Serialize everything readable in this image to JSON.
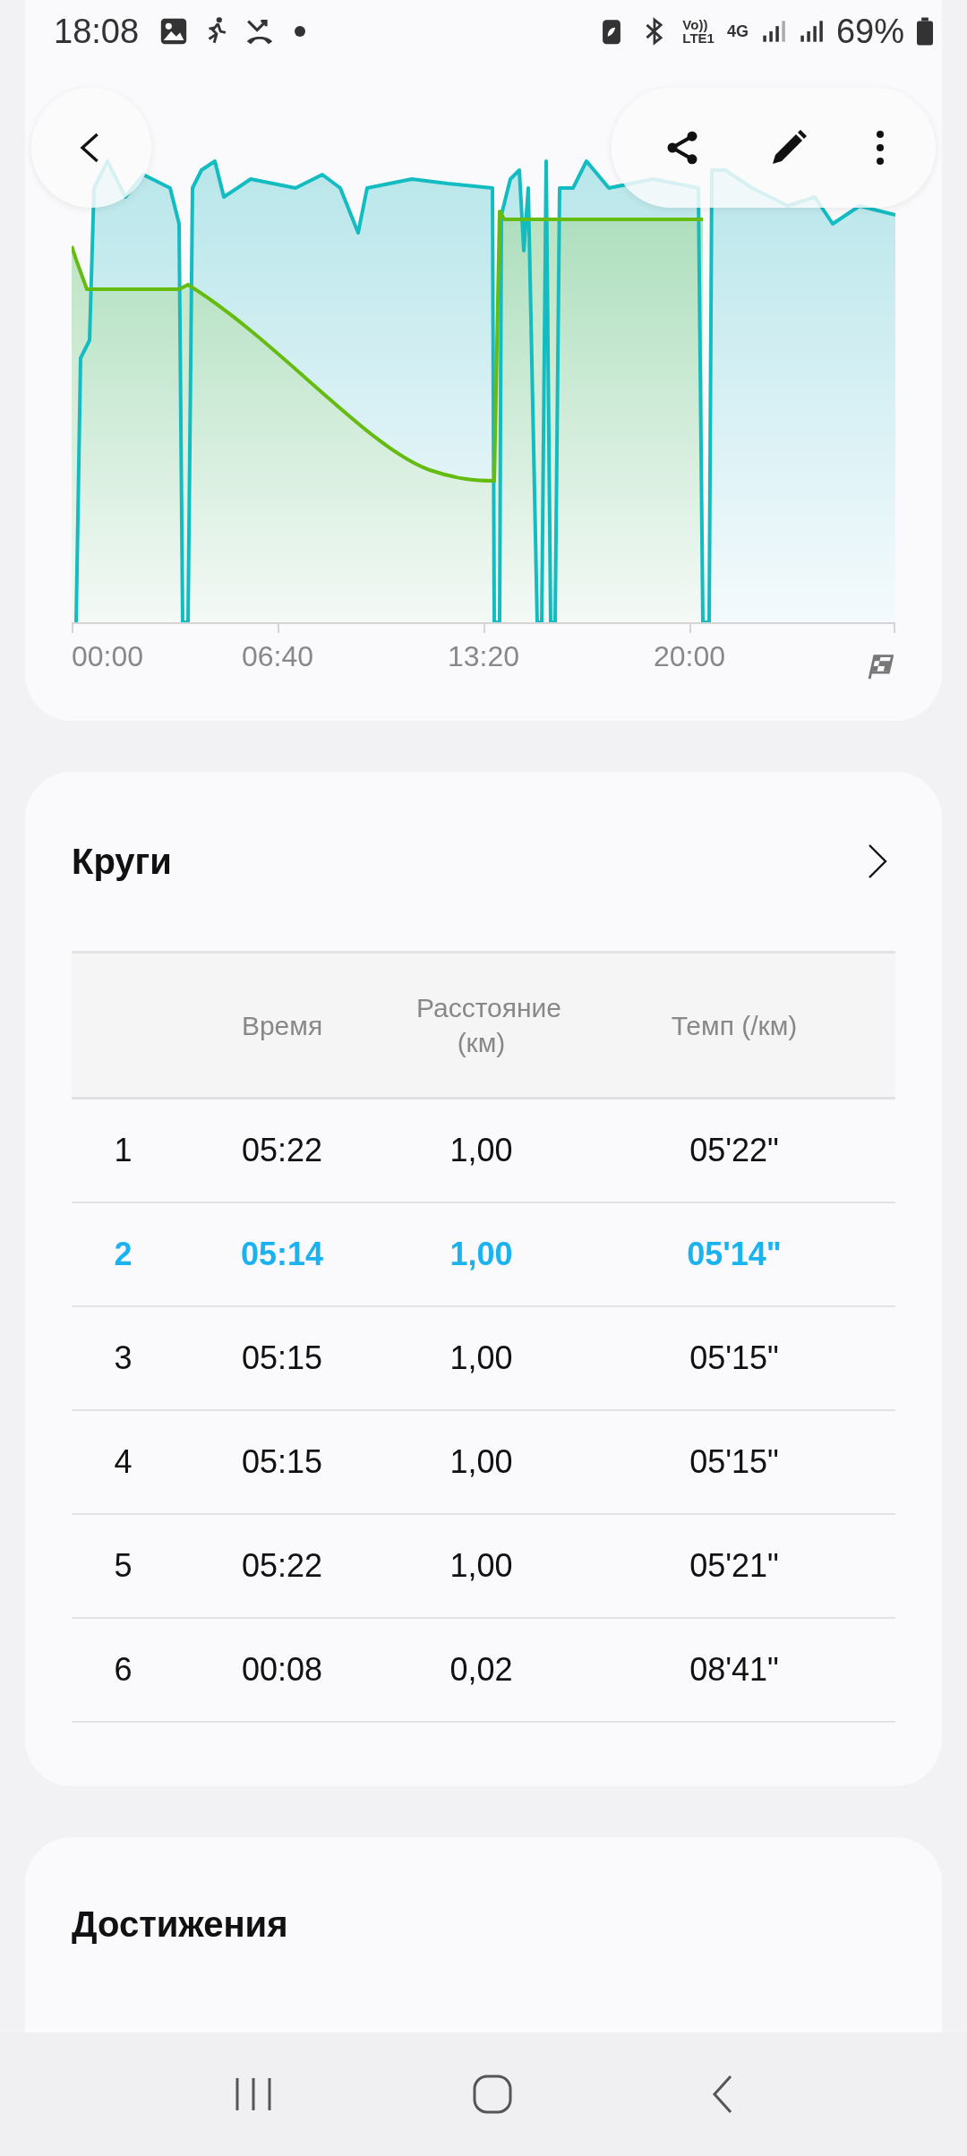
{
  "status_bar": {
    "time": "18:08",
    "volte": "Vo))",
    "lte": "LTE1",
    "network": "4G",
    "battery": "69%"
  },
  "chart": {
    "x_labels": [
      "00:00",
      "06:40",
      "13:20",
      "20:00"
    ]
  },
  "laps": {
    "title": "Круги",
    "columns": [
      "Время",
      "Расстояние (км)",
      "Темп (/км)"
    ],
    "rows": [
      {
        "lap": "1",
        "time": "05:22",
        "distance": "1,00",
        "pace": "05'22\"",
        "selected": false
      },
      {
        "lap": "2",
        "time": "05:14",
        "distance": "1,00",
        "pace": "05'14\"",
        "selected": true
      },
      {
        "lap": "3",
        "time": "05:15",
        "distance": "1,00",
        "pace": "05'15\"",
        "selected": false
      },
      {
        "lap": "4",
        "time": "05:15",
        "distance": "1,00",
        "pace": "05'15\"",
        "selected": false
      },
      {
        "lap": "5",
        "time": "05:22",
        "distance": "1,00",
        "pace": "05'21\"",
        "selected": false
      },
      {
        "lap": "6",
        "time": "00:08",
        "distance": "0,02",
        "pace": "08'41\"",
        "selected": false
      }
    ]
  },
  "achievements": {
    "title": "Достижения"
  }
}
